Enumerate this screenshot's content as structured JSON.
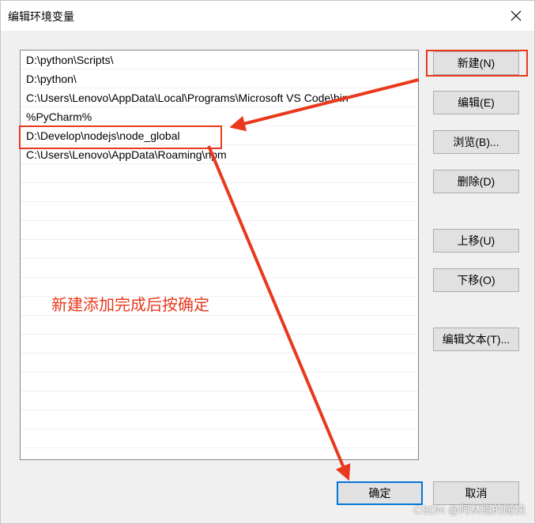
{
  "window": {
    "title": "编辑环境变量",
    "close_icon": "close-icon"
  },
  "path_list": {
    "items": [
      "D:\\python\\Scripts\\",
      "D:\\python\\",
      "C:\\Users\\Lenovo\\AppData\\Local\\Programs\\Microsoft VS Code\\bin",
      "%PyCharm%",
      "D:\\Develop\\nodejs\\node_global",
      "C:\\Users\\Lenovo\\AppData\\Roaming\\npm"
    ],
    "highlighted_item": "D:\\Develop\\nodejs\\node_global"
  },
  "buttons": {
    "new": "新建(N)",
    "edit": "编辑(E)",
    "browse": "浏览(B)...",
    "delete": "删除(D)",
    "move_up": "上移(U)",
    "move_down": "下移(O)",
    "edit_text": "编辑文本(T)...",
    "ok": "确定",
    "cancel": "取消"
  },
  "annotation": {
    "text": "新建添加完成后按确定",
    "color": "#e8391d"
  },
  "watermark": "CSDN @阿林跑的贼快"
}
